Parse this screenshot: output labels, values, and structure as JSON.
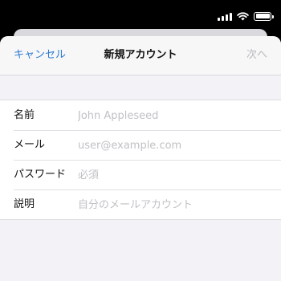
{
  "status_bar": {
    "signal_icon": "cellular-signal-icon",
    "wifi_icon": "wifi-icon",
    "battery_icon": "battery-icon",
    "battery_level": 1.0
  },
  "nav": {
    "cancel_label": "キャンセル",
    "title": "新規アカウント",
    "next_label": "次へ"
  },
  "form": {
    "rows": [
      {
        "label": "名前",
        "value": "",
        "placeholder": "John Appleseed"
      },
      {
        "label": "メール",
        "value": "",
        "placeholder": "user@example.com"
      },
      {
        "label": "パスワード",
        "value": "",
        "placeholder": "必須"
      },
      {
        "label": "説明",
        "value": "",
        "placeholder": "自分のメールアカウント"
      }
    ]
  },
  "colors": {
    "accent": "#2f7bd2",
    "disabled": "#b9b9bd",
    "background": "#f2f2f7",
    "placeholder": "#c1c1c5"
  }
}
